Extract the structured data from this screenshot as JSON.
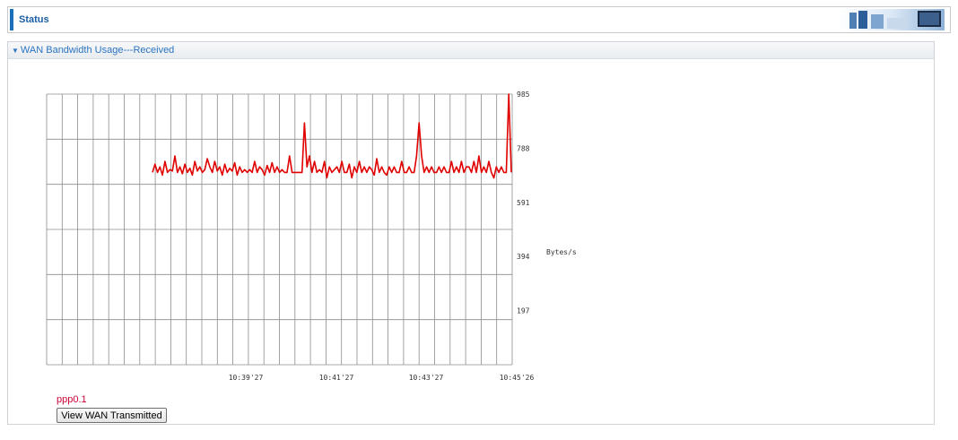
{
  "header": {
    "title": "Status"
  },
  "panel": {
    "title": "WAN Bandwidth Usage---Received"
  },
  "chart_data": {
    "type": "line",
    "title": "",
    "xlabel": "",
    "ylabel": "Bytes/s",
    "ylim": [
      0,
      985
    ],
    "yticks": [
      197,
      394,
      591,
      788,
      985
    ],
    "xtick_labels": [
      "10:39'27",
      "10:41'27",
      "10:43'27",
      "10:45'26"
    ],
    "series": [
      {
        "name": "ppp0.1",
        "color": "#e00000",
        "values": [
          700,
          730,
          700,
          720,
          690,
          740,
          700,
          710,
          705,
          760,
          700,
          720,
          695,
          730,
          700,
          715,
          690,
          740,
          705,
          720,
          700,
          710,
          750,
          720,
          700,
          740,
          705,
          720,
          690,
          730,
          700,
          715,
          705,
          735,
          690,
          720,
          700,
          710,
          700,
          710,
          700,
          740,
          700,
          720,
          710,
          690,
          725,
          700,
          735,
          700,
          720,
          700,
          710,
          700,
          700,
          760,
          700,
          700,
          700,
          700,
          700,
          880,
          720,
          760,
          700,
          740,
          700,
          710,
          700,
          740,
          680,
          720,
          700,
          710,
          720,
          700,
          740,
          700,
          700,
          730,
          680,
          720,
          700,
          740,
          700,
          720,
          700,
          720,
          710,
          690,
          750,
          700,
          720,
          700,
          690,
          720,
          700,
          720,
          700,
          700,
          740,
          700,
          700,
          720,
          700,
          700,
          760,
          880,
          760,
          700,
          720,
          700,
          720,
          700,
          700,
          720,
          700,
          720,
          700,
          700,
          740,
          700,
          720,
          700,
          740,
          700,
          720,
          720,
          700,
          740,
          700,
          760,
          700,
          720,
          700,
          740,
          700,
          680,
          720,
          700,
          720,
          700,
          700,
          985,
          700
        ]
      }
    ]
  },
  "legend": {
    "series_label": "ppp0.1"
  },
  "buttons": {
    "view_transmitted": "View WAN Transmitted"
  },
  "colors": {
    "accent": "#1c6fb8",
    "line": "#e00000",
    "grid": "#8c8c8c"
  }
}
